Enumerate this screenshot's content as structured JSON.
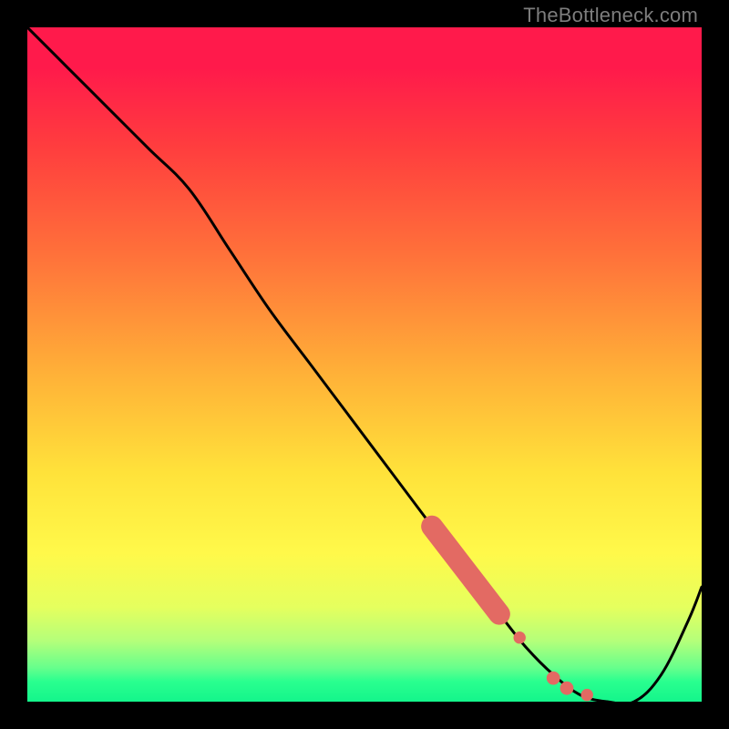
{
  "watermark": "TheBottleneck.com",
  "colors": {
    "curve": "#000000",
    "marker": "#e36a63",
    "background_black": "#000000"
  },
  "chart_data": {
    "type": "line",
    "title": "",
    "xlabel": "",
    "ylabel": "",
    "xlim": [
      0,
      100
    ],
    "ylim": [
      0,
      100
    ],
    "series": [
      {
        "name": "bottleneck-curve",
        "x": [
          0,
          6,
          12,
          18,
          24,
          30,
          36,
          42,
          48,
          54,
          60,
          66,
          70,
          74,
          78,
          82,
          86,
          90,
          94,
          98,
          100
        ],
        "y": [
          100,
          94,
          88,
          82,
          76,
          67,
          58,
          50,
          42,
          34,
          26,
          18,
          13,
          8,
          4,
          1,
          0,
          0,
          4,
          12,
          17
        ]
      }
    ],
    "markers": [
      {
        "name": "highlight-segment",
        "kind": "thick-line",
        "x0": 60,
        "y0": 26,
        "x1": 70,
        "y1": 13,
        "width": 3.2
      },
      {
        "name": "dot-1",
        "kind": "dot",
        "x": 73,
        "y": 9.5,
        "r": 0.9
      },
      {
        "name": "dot-2",
        "kind": "dot",
        "x": 78,
        "y": 3.5,
        "r": 1.0
      },
      {
        "name": "dot-3",
        "kind": "dot",
        "x": 80,
        "y": 2.0,
        "r": 1.0
      },
      {
        "name": "dot-4",
        "kind": "dot",
        "x": 83,
        "y": 1.0,
        "r": 0.9
      }
    ]
  }
}
